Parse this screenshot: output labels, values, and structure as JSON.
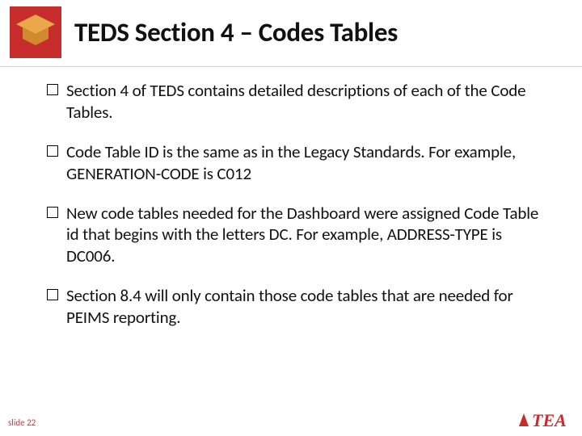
{
  "header": {
    "title": "TEDS Section 4 – Codes Tables"
  },
  "bullets": [
    "Section 4 of TEDS contains detailed descriptions of each of the Code Tables.",
    "Code Table ID is the same as in the Legacy Standards. For example, GENERATION-CODE is C012",
    "New code tables needed for the Dashboard were assigned Code Table id that begins with the letters DC. For example, ADDRESS-TYPE is DC006.",
    "Section 8.4 will only contain those code tables that are needed for PEIMS reporting."
  ],
  "footer": {
    "slide_label": "slide 22"
  },
  "branding": {
    "tea_text": "TEA"
  }
}
